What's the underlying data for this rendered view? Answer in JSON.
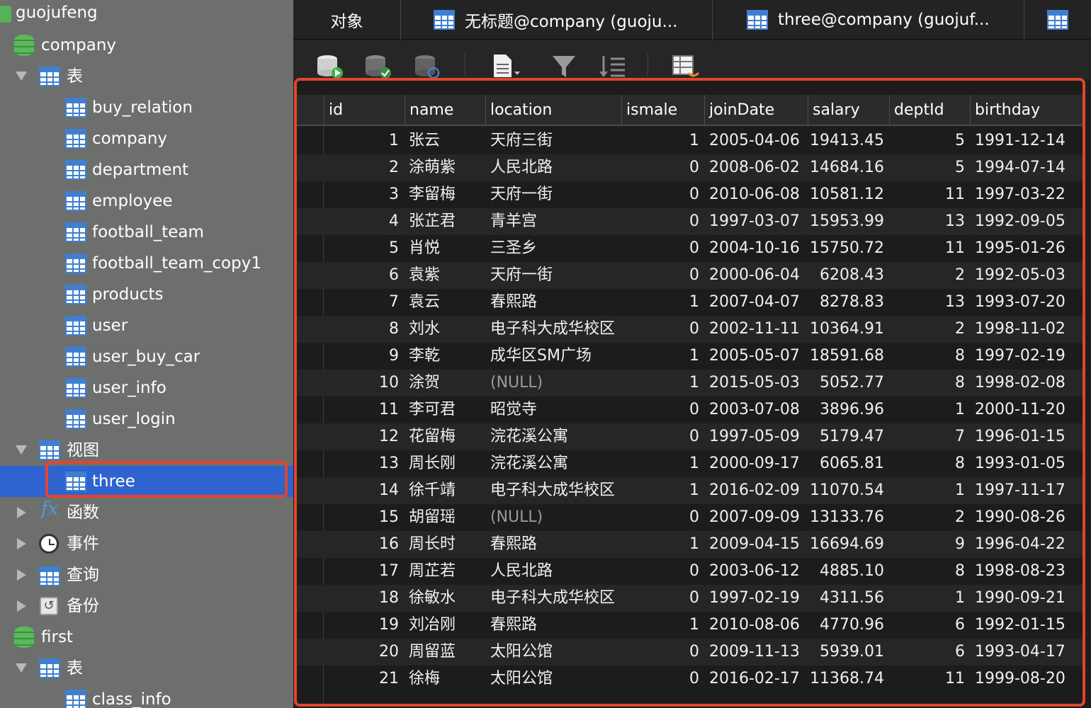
{
  "sidebar": {
    "connection": "guojufeng",
    "database_company": "company",
    "tables_label": "表",
    "tables": [
      "buy_relation",
      "company",
      "department",
      "employee",
      "football_team",
      "football_team_copy1",
      "products",
      "user",
      "user_buy_car",
      "user_info",
      "user_login"
    ],
    "views_label": "视图",
    "views": [
      "three"
    ],
    "functions_label": "函数",
    "events_label": "事件",
    "queries_label": "查询",
    "backups_label": "备份",
    "database_first": "first",
    "first_tables_label": "表",
    "first_tables": [
      "class_info"
    ]
  },
  "tabs": {
    "objects": "对象",
    "untitled": "无标题@company (guoju...",
    "three": "three@company (guojuf..."
  },
  "grid": {
    "columns": [
      "id",
      "name",
      "location",
      "ismale",
      "joinDate",
      "salary",
      "deptId",
      "birthday"
    ],
    "rows": [
      [
        "1",
        "张云",
        "天府三街",
        "1",
        "2005-04-06",
        "19413.45",
        "5",
        "1991-12-14"
      ],
      [
        "2",
        "涂萌紫",
        "人民北路",
        "0",
        "2008-06-02",
        "14684.16",
        "5",
        "1994-07-14"
      ],
      [
        "3",
        "李留梅",
        "天府一街",
        "0",
        "2010-06-08",
        "10581.12",
        "11",
        "1997-03-22"
      ],
      [
        "4",
        "张芷君",
        "青羊宫",
        "0",
        "1997-03-07",
        "15953.99",
        "13",
        "1992-09-05"
      ],
      [
        "5",
        "肖悦",
        "三圣乡",
        "0",
        "2004-10-16",
        "15750.72",
        "11",
        "1995-01-26"
      ],
      [
        "6",
        "袁紫",
        "天府一街",
        "0",
        "2000-06-04",
        "6208.43",
        "2",
        "1992-05-03"
      ],
      [
        "7",
        "袁云",
        "春熙路",
        "1",
        "2007-04-07",
        "8278.83",
        "13",
        "1993-07-20"
      ],
      [
        "8",
        "刘水",
        "电子科大成华校区",
        "0",
        "2002-11-11",
        "10364.91",
        "2",
        "1998-11-02"
      ],
      [
        "9",
        "李乾",
        "成华区SM广场",
        "1",
        "2005-05-07",
        "18591.68",
        "8",
        "1997-02-19"
      ],
      [
        "10",
        "涂贺",
        "(NULL)",
        "1",
        "2015-05-03",
        "5052.77",
        "8",
        "1998-02-08"
      ],
      [
        "11",
        "李可君",
        "昭觉寺",
        "0",
        "2003-07-08",
        "3896.96",
        "1",
        "2000-11-20"
      ],
      [
        "12",
        "花留梅",
        "浣花溪公寓",
        "0",
        "1997-05-09",
        "5179.47",
        "7",
        "1996-01-15"
      ],
      [
        "13",
        "周长刚",
        "浣花溪公寓",
        "1",
        "2000-09-17",
        "6065.81",
        "8",
        "1993-01-05"
      ],
      [
        "14",
        "徐千靖",
        "电子科大成华校区",
        "1",
        "2016-02-09",
        "11070.54",
        "1",
        "1997-11-17"
      ],
      [
        "15",
        "胡留瑶",
        "(NULL)",
        "0",
        "2007-09-09",
        "13133.76",
        "2",
        "1990-08-26"
      ],
      [
        "16",
        "周长时",
        "春熙路",
        "1",
        "2009-04-15",
        "16694.69",
        "9",
        "1996-04-22"
      ],
      [
        "17",
        "周芷若",
        "人民北路",
        "0",
        "2003-06-12",
        "4885.10",
        "8",
        "1998-08-23"
      ],
      [
        "18",
        "徐敏水",
        "电子科大成华校区",
        "0",
        "1997-02-19",
        "4311.56",
        "1",
        "1990-09-21"
      ],
      [
        "19",
        "刘冶刚",
        "春熙路",
        "1",
        "2010-08-06",
        "4770.96",
        "6",
        "1992-01-15"
      ],
      [
        "20",
        "周留蓝",
        "太阳公馆",
        "0",
        "2009-11-13",
        "5939.01",
        "6",
        "1993-04-17"
      ],
      [
        "21",
        "徐梅",
        "太阳公馆",
        "0",
        "2016-02-17",
        "11368.74",
        "11",
        "1999-08-20"
      ]
    ]
  }
}
